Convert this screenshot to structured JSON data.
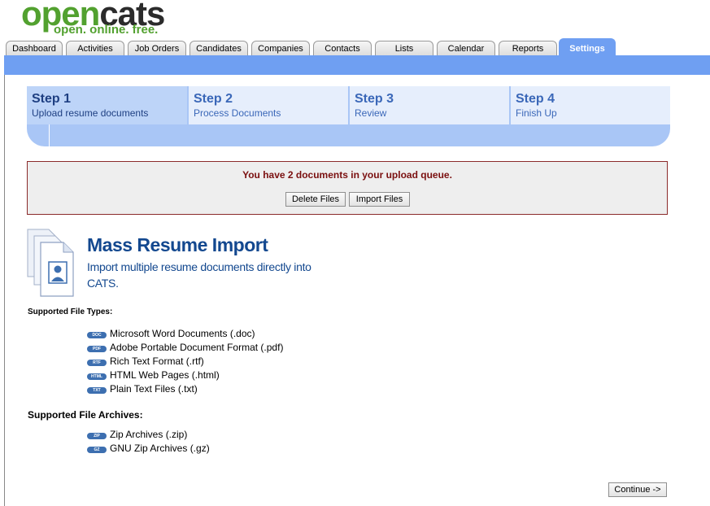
{
  "logo": {
    "word_open": "open",
    "word_cats": "cats",
    "tagline": "open. online. free."
  },
  "tabs": [
    "Dashboard",
    "Activities",
    "Job Orders",
    "Candidates",
    "Companies",
    "Contacts",
    "Lists",
    "Calendar",
    "Reports",
    "Settings"
  ],
  "active_tab": "Settings",
  "steps": [
    {
      "title": "Step 1",
      "subtitle": "Upload resume documents"
    },
    {
      "title": "Step 2",
      "subtitle": "Process Documents"
    },
    {
      "title": "Step 3",
      "subtitle": "Review"
    },
    {
      "title": "Step 4",
      "subtitle": "Finish Up"
    }
  ],
  "queue": {
    "message": "You have 2 documents in your upload queue.",
    "delete_label": "Delete Files",
    "import_label": "Import Files"
  },
  "hero": {
    "title": "Mass Resume Import",
    "description": "Import multiple resume documents directly into CATS."
  },
  "file_types_label": "Supported File Types:",
  "file_types": [
    {
      "badge": "DOC",
      "label": "Microsoft Word Documents (.doc)"
    },
    {
      "badge": "PDF",
      "label": "Adobe Portable Document Format (.pdf)"
    },
    {
      "badge": "RTF",
      "label": "Rich Text Format (.rtf)"
    },
    {
      "badge": "HTML",
      "label": "HTML Web Pages (.html)"
    },
    {
      "badge": "TXT",
      "label": "Plain Text Files (.txt)"
    }
  ],
  "archives_label": "Supported File Archives:",
  "archives": [
    {
      "badge": "ZIP",
      "label": "Zip Archives (.zip)"
    },
    {
      "badge": "GZ",
      "label": "GNU Zip Archives (.gz)"
    }
  ],
  "continue_label": "Continue ->",
  "colors": {
    "accent": "#6f9ff2",
    "title_blue": "#13488f",
    "alert_red": "#7a0f0f",
    "logo_green": "#52a12f"
  }
}
